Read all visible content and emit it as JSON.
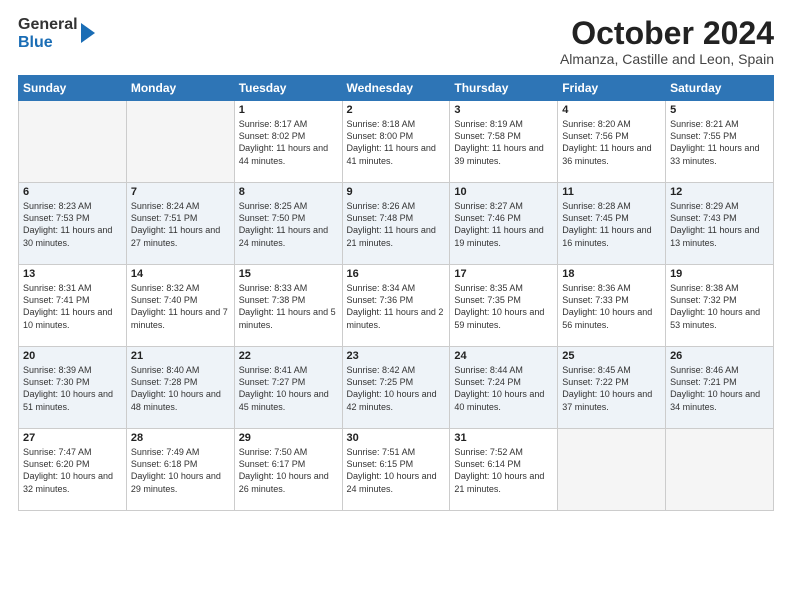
{
  "logo": {
    "general": "General",
    "blue": "Blue"
  },
  "header": {
    "month": "October 2024",
    "location": "Almanza, Castille and Leon, Spain"
  },
  "days_of_week": [
    "Sunday",
    "Monday",
    "Tuesday",
    "Wednesday",
    "Thursday",
    "Friday",
    "Saturday"
  ],
  "weeks": [
    [
      {
        "day": "",
        "detail": ""
      },
      {
        "day": "",
        "detail": ""
      },
      {
        "day": "1",
        "detail": "Sunrise: 8:17 AM\nSunset: 8:02 PM\nDaylight: 11 hours and 44 minutes."
      },
      {
        "day": "2",
        "detail": "Sunrise: 8:18 AM\nSunset: 8:00 PM\nDaylight: 11 hours and 41 minutes."
      },
      {
        "day": "3",
        "detail": "Sunrise: 8:19 AM\nSunset: 7:58 PM\nDaylight: 11 hours and 39 minutes."
      },
      {
        "day": "4",
        "detail": "Sunrise: 8:20 AM\nSunset: 7:56 PM\nDaylight: 11 hours and 36 minutes."
      },
      {
        "day": "5",
        "detail": "Sunrise: 8:21 AM\nSunset: 7:55 PM\nDaylight: 11 hours and 33 minutes."
      }
    ],
    [
      {
        "day": "6",
        "detail": "Sunrise: 8:23 AM\nSunset: 7:53 PM\nDaylight: 11 hours and 30 minutes."
      },
      {
        "day": "7",
        "detail": "Sunrise: 8:24 AM\nSunset: 7:51 PM\nDaylight: 11 hours and 27 minutes."
      },
      {
        "day": "8",
        "detail": "Sunrise: 8:25 AM\nSunset: 7:50 PM\nDaylight: 11 hours and 24 minutes."
      },
      {
        "day": "9",
        "detail": "Sunrise: 8:26 AM\nSunset: 7:48 PM\nDaylight: 11 hours and 21 minutes."
      },
      {
        "day": "10",
        "detail": "Sunrise: 8:27 AM\nSunset: 7:46 PM\nDaylight: 11 hours and 19 minutes."
      },
      {
        "day": "11",
        "detail": "Sunrise: 8:28 AM\nSunset: 7:45 PM\nDaylight: 11 hours and 16 minutes."
      },
      {
        "day": "12",
        "detail": "Sunrise: 8:29 AM\nSunset: 7:43 PM\nDaylight: 11 hours and 13 minutes."
      }
    ],
    [
      {
        "day": "13",
        "detail": "Sunrise: 8:31 AM\nSunset: 7:41 PM\nDaylight: 11 hours and 10 minutes."
      },
      {
        "day": "14",
        "detail": "Sunrise: 8:32 AM\nSunset: 7:40 PM\nDaylight: 11 hours and 7 minutes."
      },
      {
        "day": "15",
        "detail": "Sunrise: 8:33 AM\nSunset: 7:38 PM\nDaylight: 11 hours and 5 minutes."
      },
      {
        "day": "16",
        "detail": "Sunrise: 8:34 AM\nSunset: 7:36 PM\nDaylight: 11 hours and 2 minutes."
      },
      {
        "day": "17",
        "detail": "Sunrise: 8:35 AM\nSunset: 7:35 PM\nDaylight: 10 hours and 59 minutes."
      },
      {
        "day": "18",
        "detail": "Sunrise: 8:36 AM\nSunset: 7:33 PM\nDaylight: 10 hours and 56 minutes."
      },
      {
        "day": "19",
        "detail": "Sunrise: 8:38 AM\nSunset: 7:32 PM\nDaylight: 10 hours and 53 minutes."
      }
    ],
    [
      {
        "day": "20",
        "detail": "Sunrise: 8:39 AM\nSunset: 7:30 PM\nDaylight: 10 hours and 51 minutes."
      },
      {
        "day": "21",
        "detail": "Sunrise: 8:40 AM\nSunset: 7:28 PM\nDaylight: 10 hours and 48 minutes."
      },
      {
        "day": "22",
        "detail": "Sunrise: 8:41 AM\nSunset: 7:27 PM\nDaylight: 10 hours and 45 minutes."
      },
      {
        "day": "23",
        "detail": "Sunrise: 8:42 AM\nSunset: 7:25 PM\nDaylight: 10 hours and 42 minutes."
      },
      {
        "day": "24",
        "detail": "Sunrise: 8:44 AM\nSunset: 7:24 PM\nDaylight: 10 hours and 40 minutes."
      },
      {
        "day": "25",
        "detail": "Sunrise: 8:45 AM\nSunset: 7:22 PM\nDaylight: 10 hours and 37 minutes."
      },
      {
        "day": "26",
        "detail": "Sunrise: 8:46 AM\nSunset: 7:21 PM\nDaylight: 10 hours and 34 minutes."
      }
    ],
    [
      {
        "day": "27",
        "detail": "Sunrise: 7:47 AM\nSunset: 6:20 PM\nDaylight: 10 hours and 32 minutes."
      },
      {
        "day": "28",
        "detail": "Sunrise: 7:49 AM\nSunset: 6:18 PM\nDaylight: 10 hours and 29 minutes."
      },
      {
        "day": "29",
        "detail": "Sunrise: 7:50 AM\nSunset: 6:17 PM\nDaylight: 10 hours and 26 minutes."
      },
      {
        "day": "30",
        "detail": "Sunrise: 7:51 AM\nSunset: 6:15 PM\nDaylight: 10 hours and 24 minutes."
      },
      {
        "day": "31",
        "detail": "Sunrise: 7:52 AM\nSunset: 6:14 PM\nDaylight: 10 hours and 21 minutes."
      },
      {
        "day": "",
        "detail": ""
      },
      {
        "day": "",
        "detail": ""
      }
    ]
  ]
}
